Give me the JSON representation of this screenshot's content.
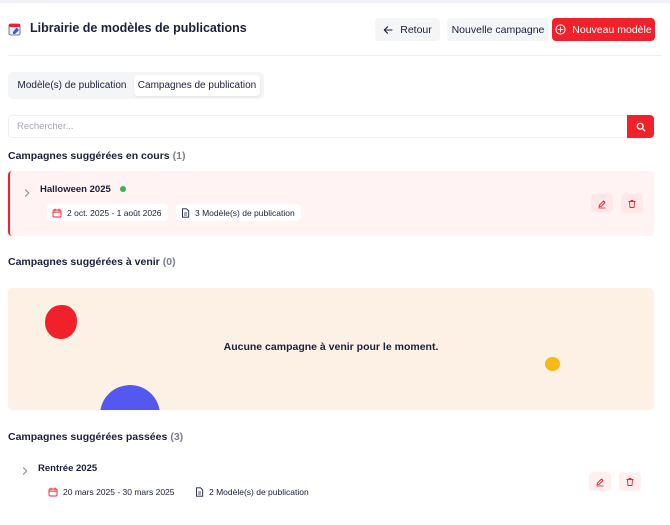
{
  "header": {
    "title": "Librairie de modèles de publications",
    "back_label": "Retour",
    "new_campaign_label": "Nouvelle campagne",
    "new_template_label": "Nouveau modèle"
  },
  "tabs": [
    {
      "label": "Modèle(s) de publication",
      "active": false
    },
    {
      "label": "Campagnes de publication",
      "active": true
    }
  ],
  "search": {
    "placeholder": "Rechercher...",
    "value": ""
  },
  "sections": {
    "current": {
      "title": "Campagnes suggérées en cours",
      "count": "(1)",
      "items": [
        {
          "name": "Halloween 2025",
          "status": "active",
          "dates": "2 oct. 2025 - 1 août 2026",
          "templates": "3 Modèle(s) de publication"
        }
      ]
    },
    "upcoming": {
      "title": "Campagnes suggérées à venir",
      "count": "(0)",
      "empty_message": "Aucune campagne à venir pour le moment."
    },
    "past": {
      "title": "Campagnes suggérées passées",
      "count": "(3)",
      "items": [
        {
          "name": "Rentrée 2025",
          "dates": "20 mars 2025 - 30 mars 2025",
          "templates": "2 Modèle(s) de publication"
        }
      ]
    }
  },
  "colors": {
    "accent": "#f0212b",
    "current_card_bg": "#fff4f3",
    "empty_bg": "#fdf1e6",
    "status_active": "#3fb24f",
    "blob_blue": "#5458f0",
    "blob_yellow": "#f5b919"
  },
  "icons": {
    "app": "book-icon",
    "back": "arrow-left-icon",
    "new": "plus-circle-icon",
    "search": "search-icon",
    "expand": "chevron-right-icon",
    "date": "calendar-icon",
    "templates": "document-icon",
    "edit": "pencil-icon",
    "delete": "trash-icon"
  }
}
